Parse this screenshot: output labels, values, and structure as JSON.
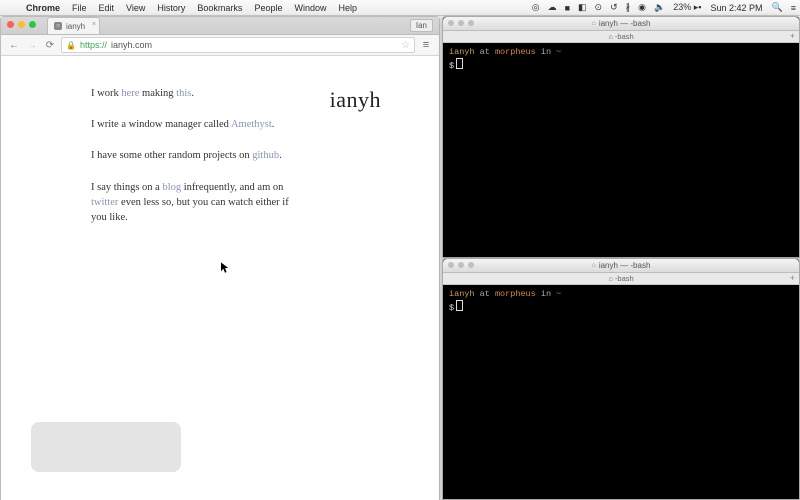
{
  "menubar": {
    "app": "Chrome",
    "items": [
      "File",
      "Edit",
      "View",
      "History",
      "Bookmarks",
      "People",
      "Window",
      "Help"
    ],
    "right": {
      "battery": "23%",
      "day": "Sun",
      "time": "2:42 PM"
    }
  },
  "chrome": {
    "tab_title": "ianyh",
    "user_button": "Ian",
    "url_scheme": "https://",
    "url_host": "ianyh.com",
    "page": {
      "logo": "ianyh",
      "line1_a": "I work ",
      "line1_link1": "here",
      "line1_b": " making ",
      "line1_link2": "this",
      "line1_c": ".",
      "line2_a": "I write a window manager called ",
      "line2_link": "Amethyst",
      "line2_b": ".",
      "line3_a": "I have some other random projects on ",
      "line3_link": "github",
      "line3_b": ".",
      "line4_a": "I say things on a ",
      "line4_link1": "blog",
      "line4_b": " infrequently, and am on ",
      "line4_link2": "twitter",
      "line4_c": " even less so, but you can watch either if you like."
    }
  },
  "terminal": {
    "title": "ianyh — -bash",
    "tab_label": "⌂ -bash",
    "prompt_user": "ianyh",
    "prompt_at": "at",
    "prompt_host": "morpheus",
    "prompt_in": "in",
    "prompt_path": "~",
    "prompt_sym": "$"
  }
}
